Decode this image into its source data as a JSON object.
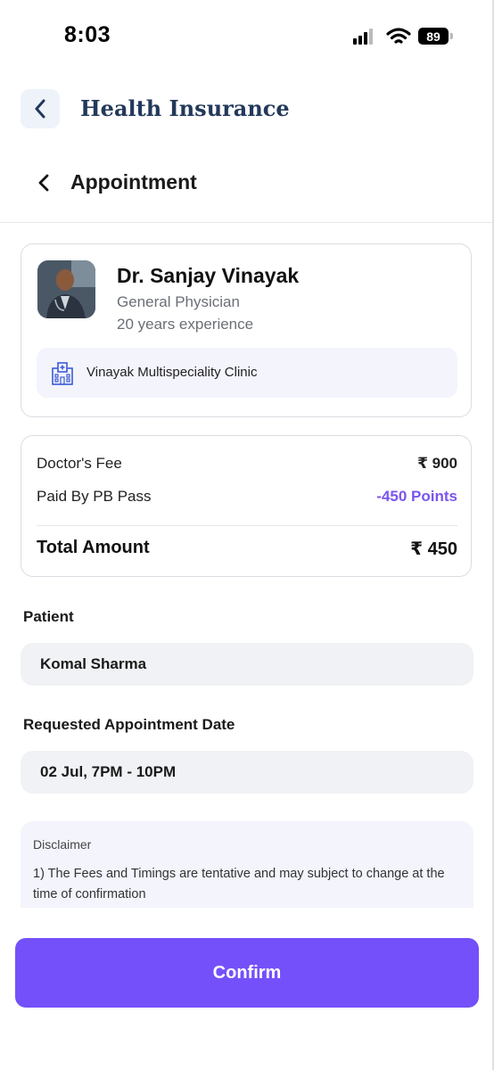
{
  "status_bar": {
    "time": "8:03",
    "battery": "89"
  },
  "app_header": {
    "title": "Health Insurance"
  },
  "sub_header": {
    "title": "Appointment"
  },
  "doctor": {
    "name": "Dr. Sanjay Vinayak",
    "specialty": "General Physician",
    "experience": "20 years experience",
    "clinic": "Vinayak Multispeciality Clinic"
  },
  "fees": {
    "doctor_fee_label": "Doctor's Fee",
    "doctor_fee_value": "₹ 900",
    "paid_label": "Paid By PB Pass",
    "paid_value": "-450 Points",
    "total_label": "Total Amount",
    "total_value": "₹ 450"
  },
  "patient": {
    "label": "Patient",
    "value": "Komal Sharma"
  },
  "appointment_date": {
    "label": "Requested Appointment Date",
    "value": "02 Jul, 7PM - 10PM"
  },
  "disclaimer": {
    "title": "Disclaimer",
    "text": "1) The Fees and Timings are tentative and may subject to change at the time of confirmation"
  },
  "confirm_label": "Confirm",
  "colors": {
    "accent": "#7450fb",
    "points": "#7a55ee",
    "header_title": "#23395b"
  }
}
